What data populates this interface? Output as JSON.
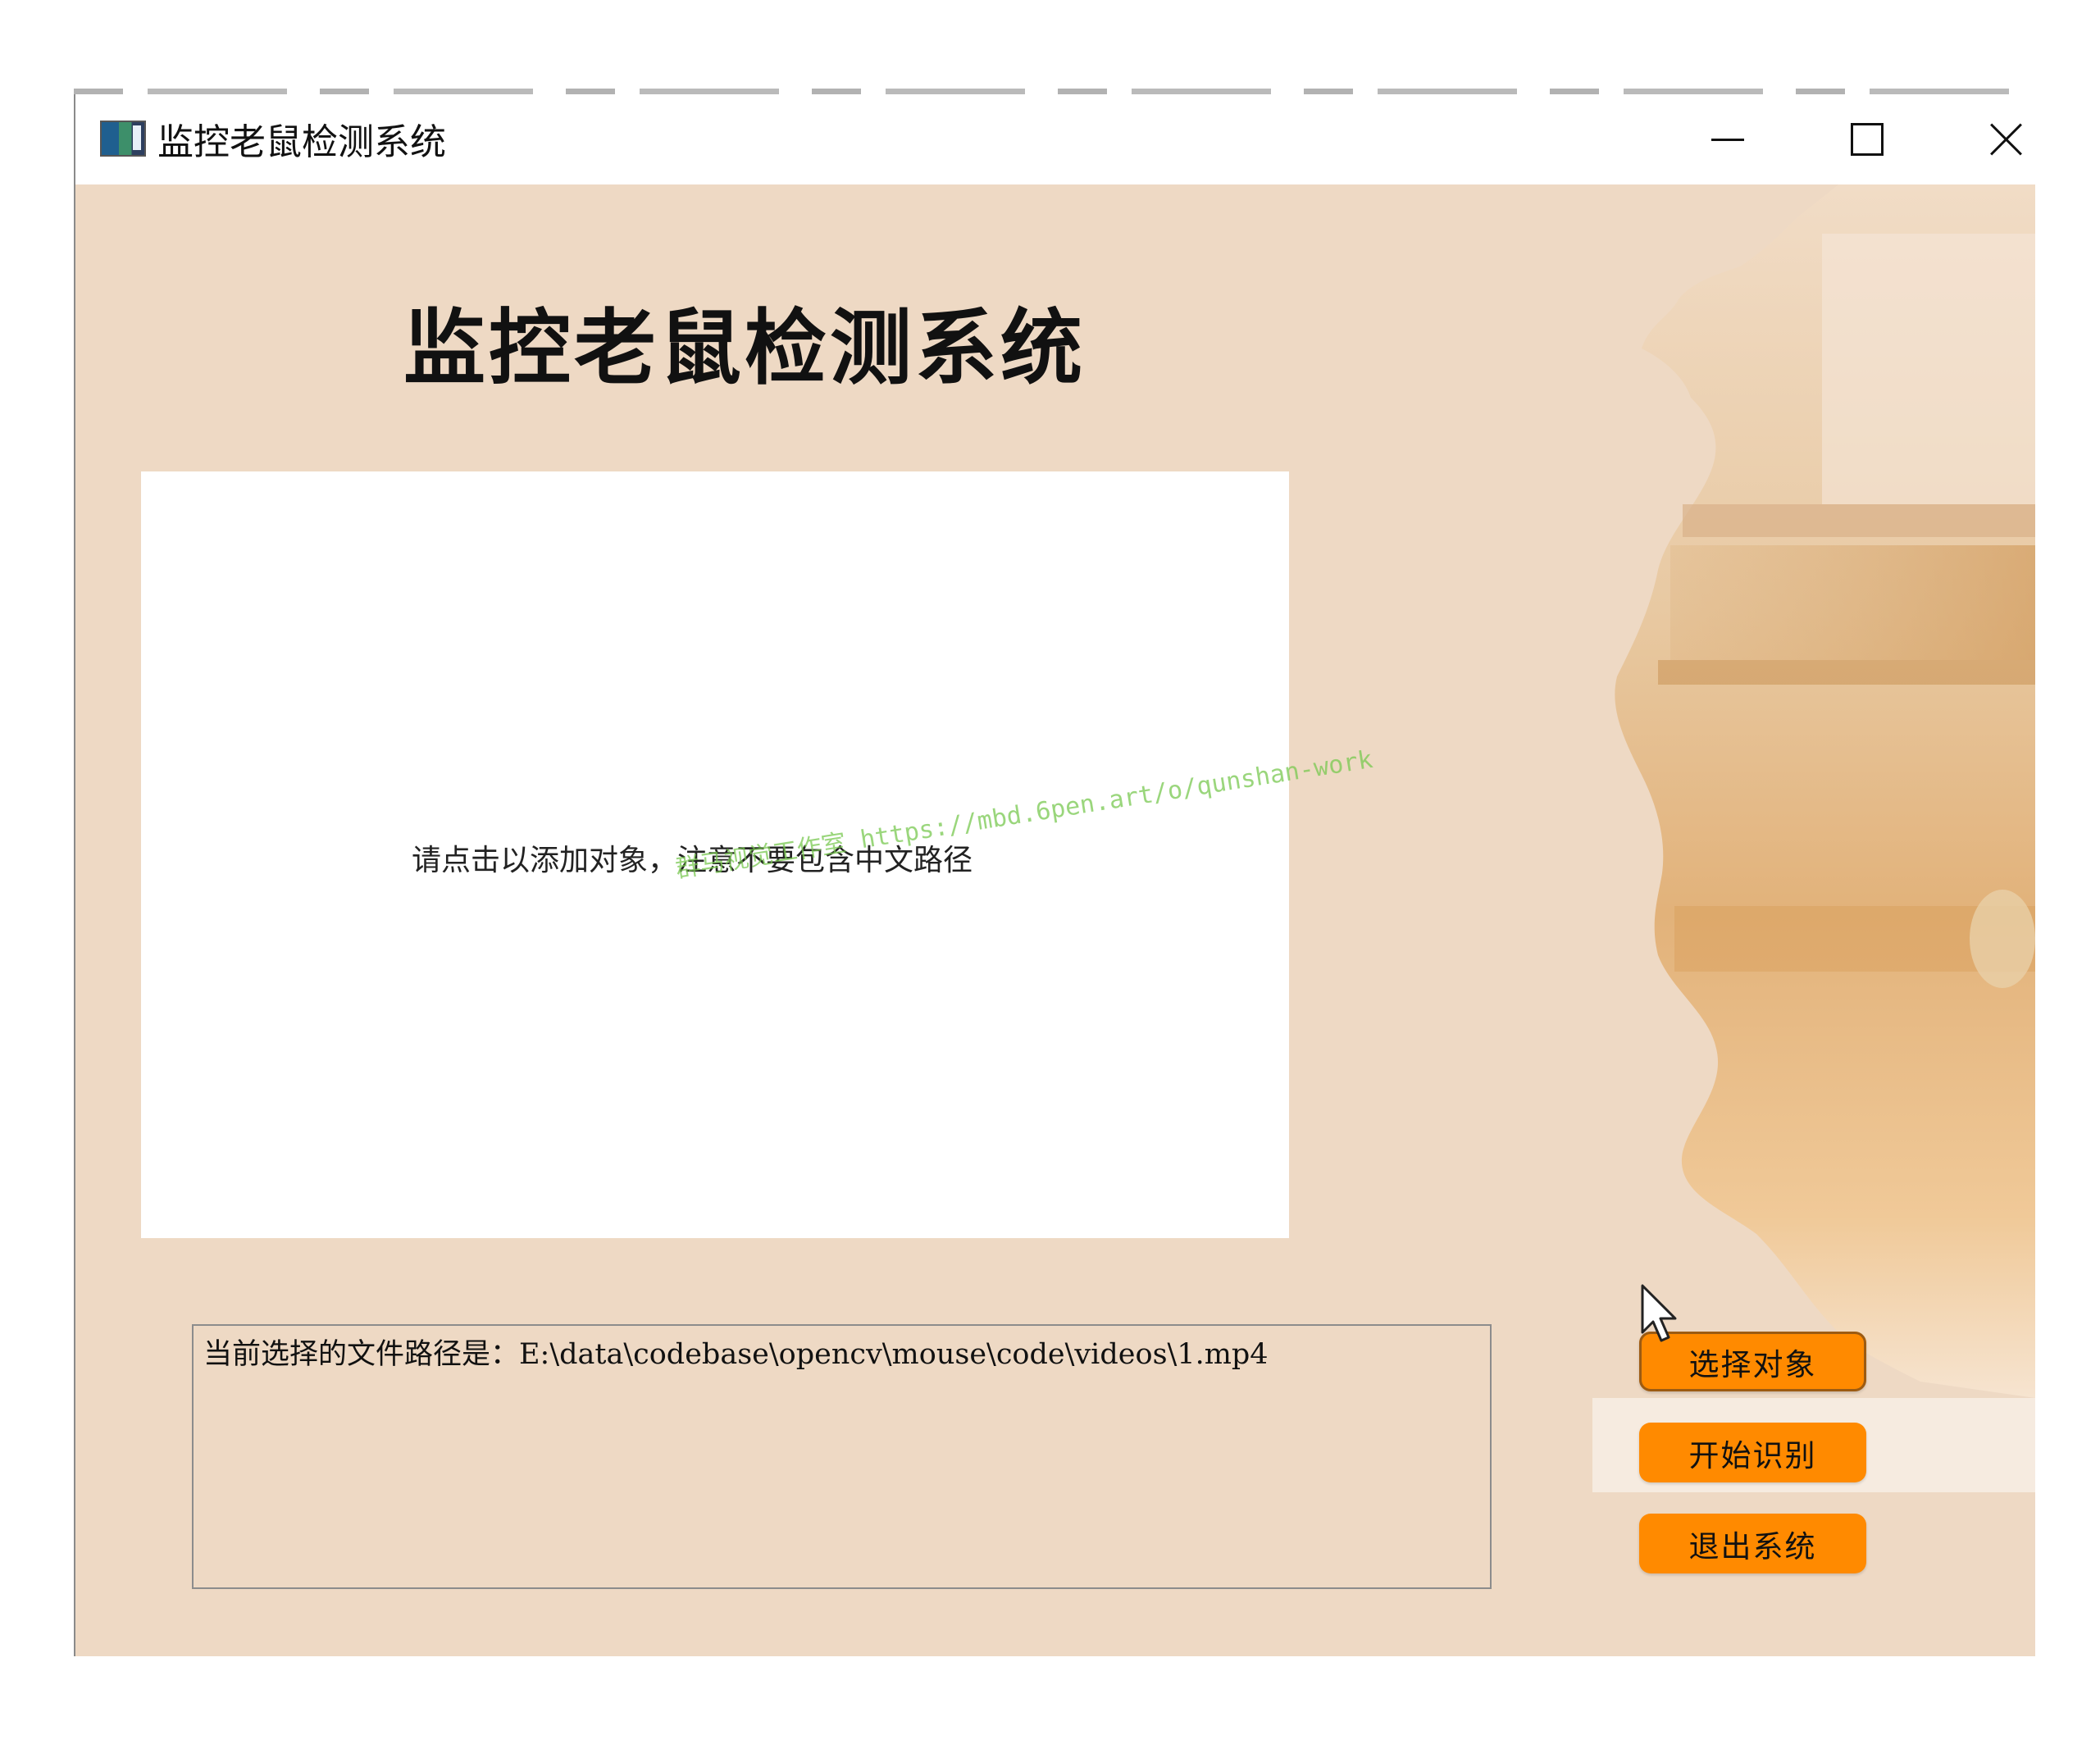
{
  "window": {
    "title": "监控老鼠检测系统"
  },
  "main": {
    "title": "监控老鼠检测系统",
    "preview_hint": "请点击以添加对象，注意不要包含中文路径",
    "watermark": "群马视觉工作室 https://mbd.6pen.art/o/qunshan-work",
    "path_text": "当前选择的文件路径是：E:\\data\\codebase\\opencv\\mouse\\code\\videos\\1.mp4"
  },
  "buttons": {
    "select": "选择对象",
    "start": "开始识别",
    "exit": "退出系统"
  },
  "colors": {
    "background": "#eed9c4",
    "button": "#ff8a00",
    "panel": "#ffffff"
  },
  "icons": {
    "app": "app-icon",
    "minimize": "minimize-icon",
    "maximize": "maximize-icon",
    "close": "close-icon",
    "cursor": "mouse-cursor-icon"
  }
}
